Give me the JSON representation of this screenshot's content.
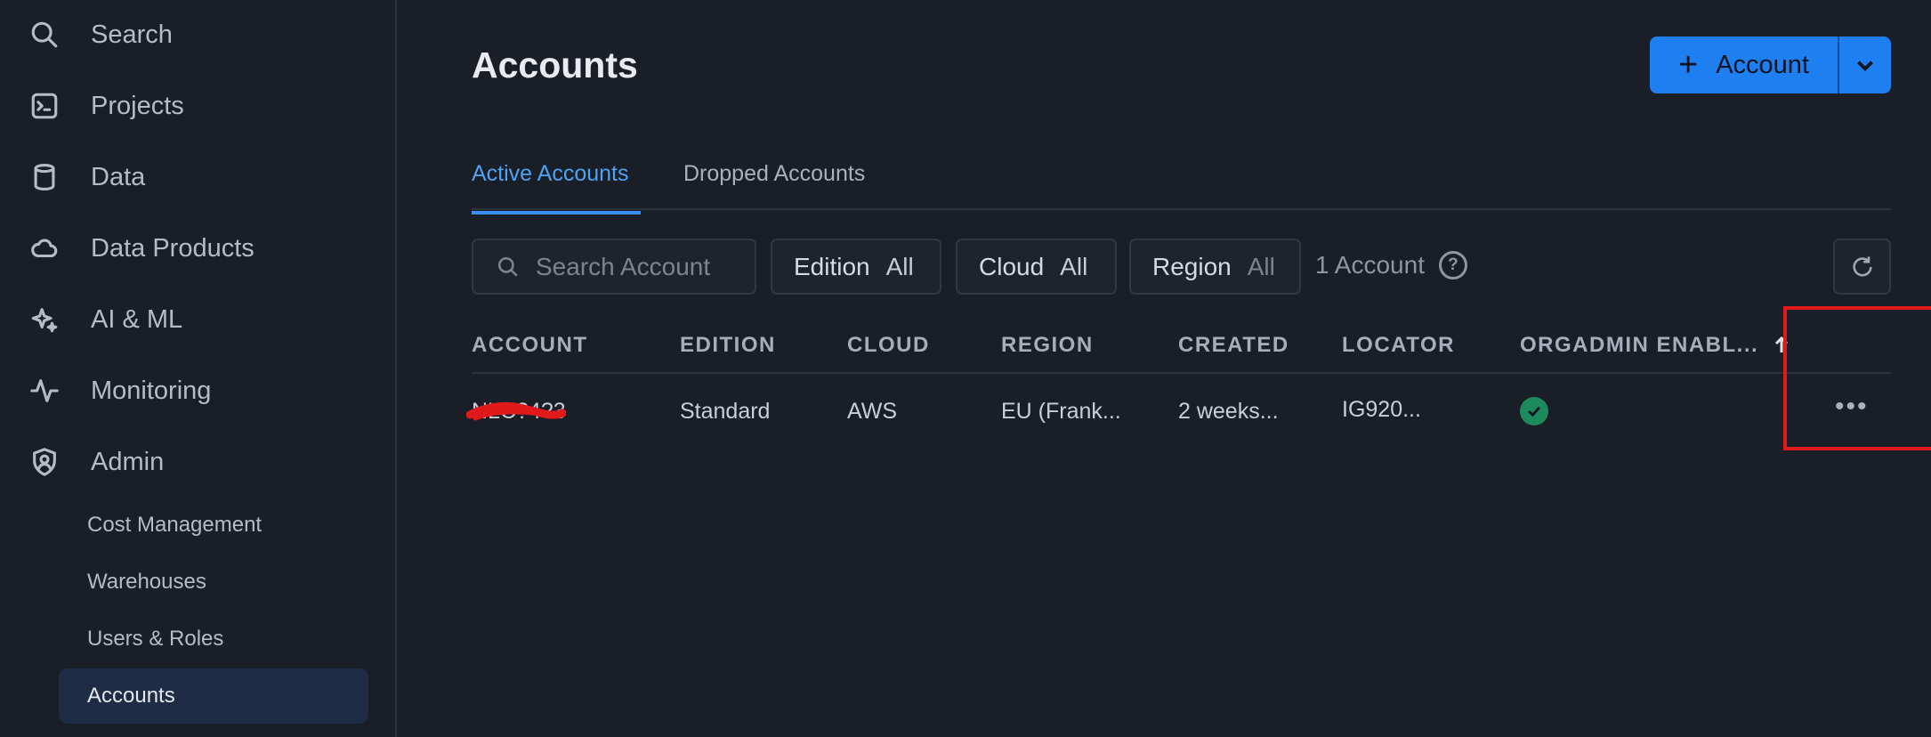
{
  "sidebar": {
    "items": [
      {
        "label": "Search",
        "icon": "search-icon"
      },
      {
        "label": "Projects",
        "icon": "terminal-icon"
      },
      {
        "label": "Data",
        "icon": "database-icon"
      },
      {
        "label": "Data Products",
        "icon": "cloud-icon"
      },
      {
        "label": "AI & ML",
        "icon": "sparkle-icon"
      },
      {
        "label": "Monitoring",
        "icon": "activity-icon"
      },
      {
        "label": "Admin",
        "icon": "shield-user-icon"
      }
    ],
    "admin_sub": [
      {
        "label": "Cost Management"
      },
      {
        "label": "Warehouses"
      },
      {
        "label": "Users & Roles"
      },
      {
        "label": "Accounts",
        "active": true
      }
    ]
  },
  "header": {
    "title": "Accounts",
    "add_button_label": "Account"
  },
  "tabs": [
    {
      "label": "Active Accounts",
      "active": true
    },
    {
      "label": "Dropped Accounts",
      "active": false
    }
  ],
  "filters": {
    "search_placeholder": "Search Account",
    "edition": {
      "label": "Edition",
      "value": "All"
    },
    "cloud": {
      "label": "Cloud",
      "value": "All"
    },
    "region": {
      "label": "Region",
      "value": "All"
    },
    "count": "1 Account"
  },
  "table": {
    "columns": [
      "ACCOUNT",
      "EDITION",
      "CLOUD",
      "REGION",
      "CREATED",
      "LOCATOR",
      "ORGADMIN ENABL..."
    ],
    "rows": [
      {
        "account": "NLC?4?3",
        "edition": "Standard",
        "cloud": "AWS",
        "region": "EU (Frank...",
        "created": "2 weeks...",
        "locator": "IG920...",
        "orgadmin_enabled": true
      }
    ]
  },
  "colors": {
    "accent": "#1d7ff0",
    "tab_active": "#4ea2f4",
    "success": "#1d8a5d",
    "highlight": "#e0191b"
  }
}
